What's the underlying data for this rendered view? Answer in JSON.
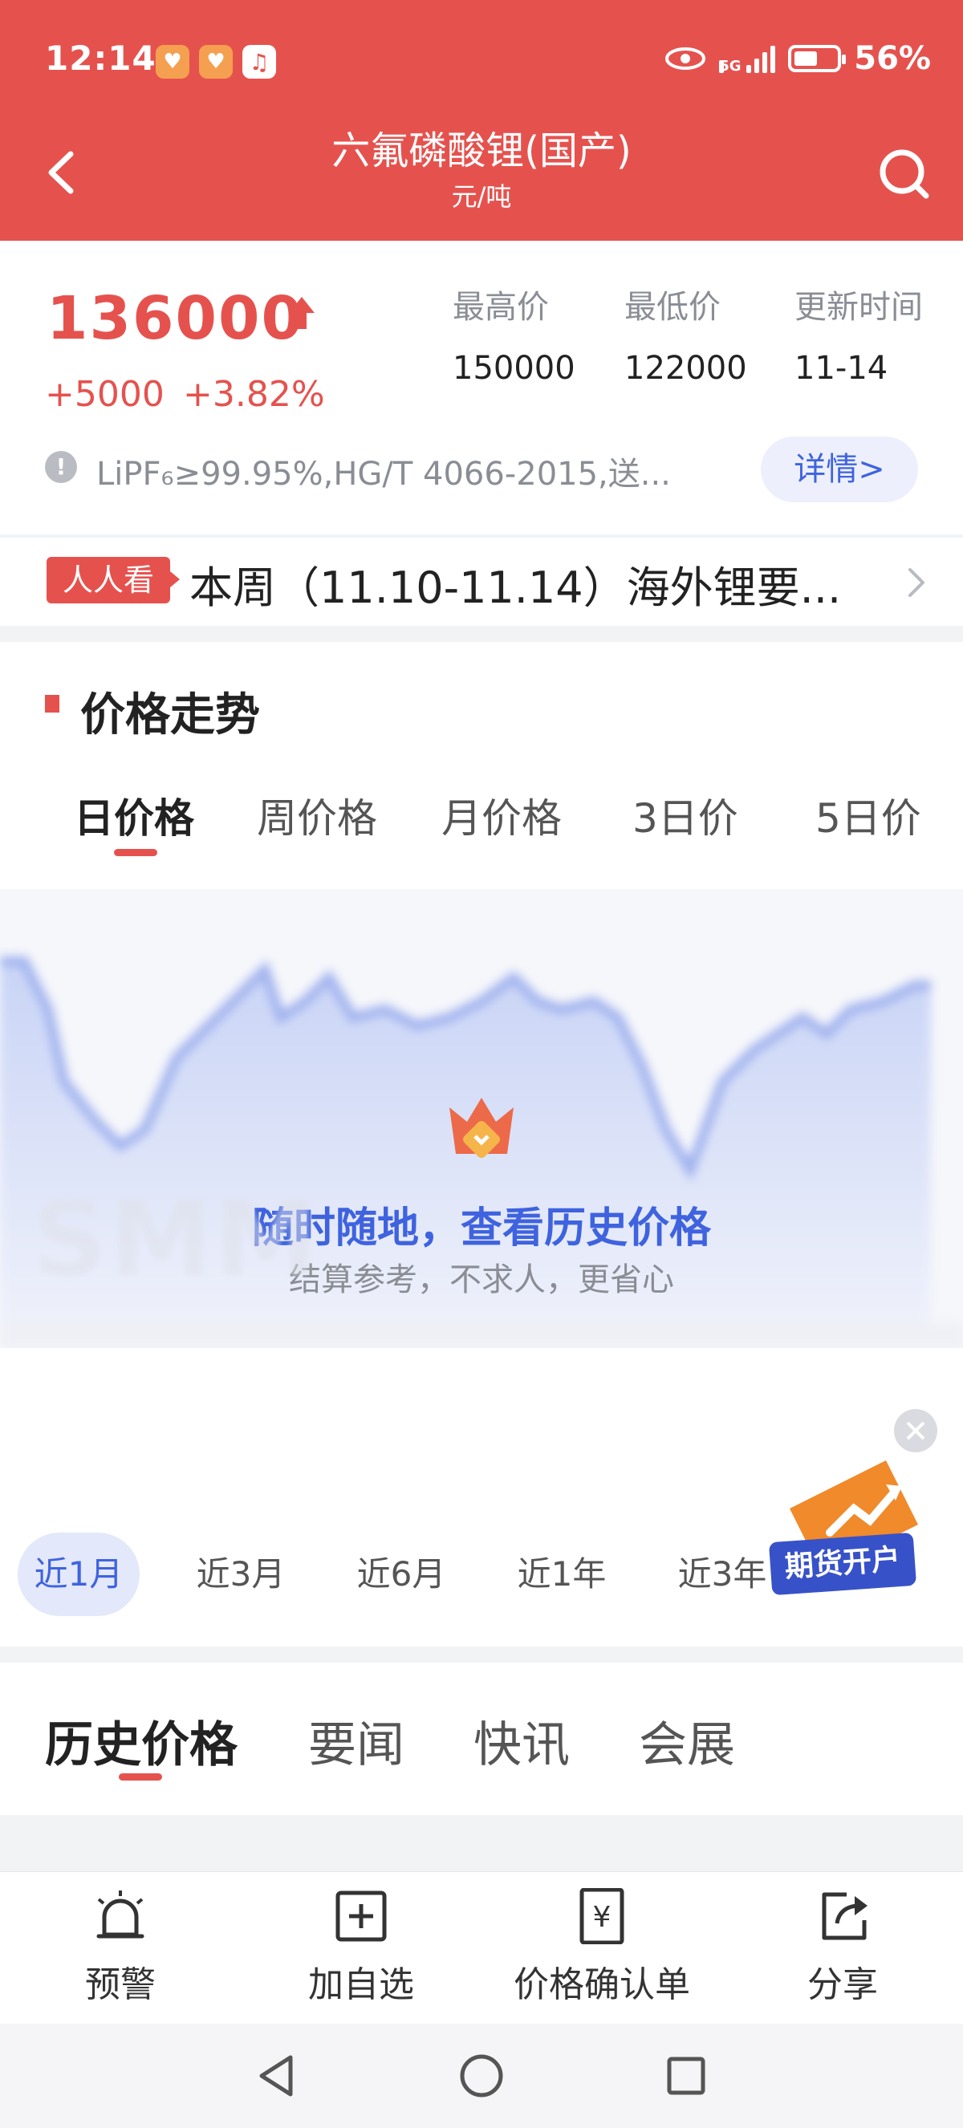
{
  "status_bar": {
    "time": "12:14",
    "network": "5G",
    "battery": "56%"
  },
  "nav": {
    "title": "六氟磷酸锂(国产)",
    "subtitle": "元/吨"
  },
  "price": {
    "current": "136000",
    "change_abs": "+5000",
    "change_pct": "+3.82%",
    "stats": [
      {
        "label": "最高价",
        "value": "150000"
      },
      {
        "label": "最低价",
        "value": "122000"
      },
      {
        "label": "更新时间",
        "value": "11-14"
      }
    ],
    "spec": "LiPF₆≥99.95%,HG/T 4066-2015,送...",
    "detail_btn": "详情>"
  },
  "news": {
    "badge": "人人看",
    "text": "本周（11.10-11.14）海外锂要..."
  },
  "trend": {
    "title": "价格走势",
    "tabs": [
      "日价格",
      "周价格",
      "月价格",
      "3日价",
      "5日价"
    ],
    "active_tab": 0,
    "promo_title": "随时随地，查看历史价格",
    "promo_sub": "结算参考，不求人，更省心",
    "watermark": "SMM",
    "ranges": [
      "近1月",
      "近3月",
      "近6月",
      "近1年",
      "近3年"
    ],
    "active_range": 0,
    "futures_label": "期货开户",
    "accent": "#e5524e",
    "link_color": "#3f63df"
  },
  "content_tabs": {
    "items": [
      "历史价格",
      "要闻",
      "快讯",
      "会展"
    ],
    "active": 0
  },
  "actions": [
    {
      "label": "预警",
      "icon": "alarm-icon"
    },
    {
      "label": "加自选",
      "icon": "add-favorite-icon"
    },
    {
      "label": "价格确认单",
      "icon": "price-receipt-icon"
    },
    {
      "label": "分享",
      "icon": "share-icon"
    }
  ]
}
